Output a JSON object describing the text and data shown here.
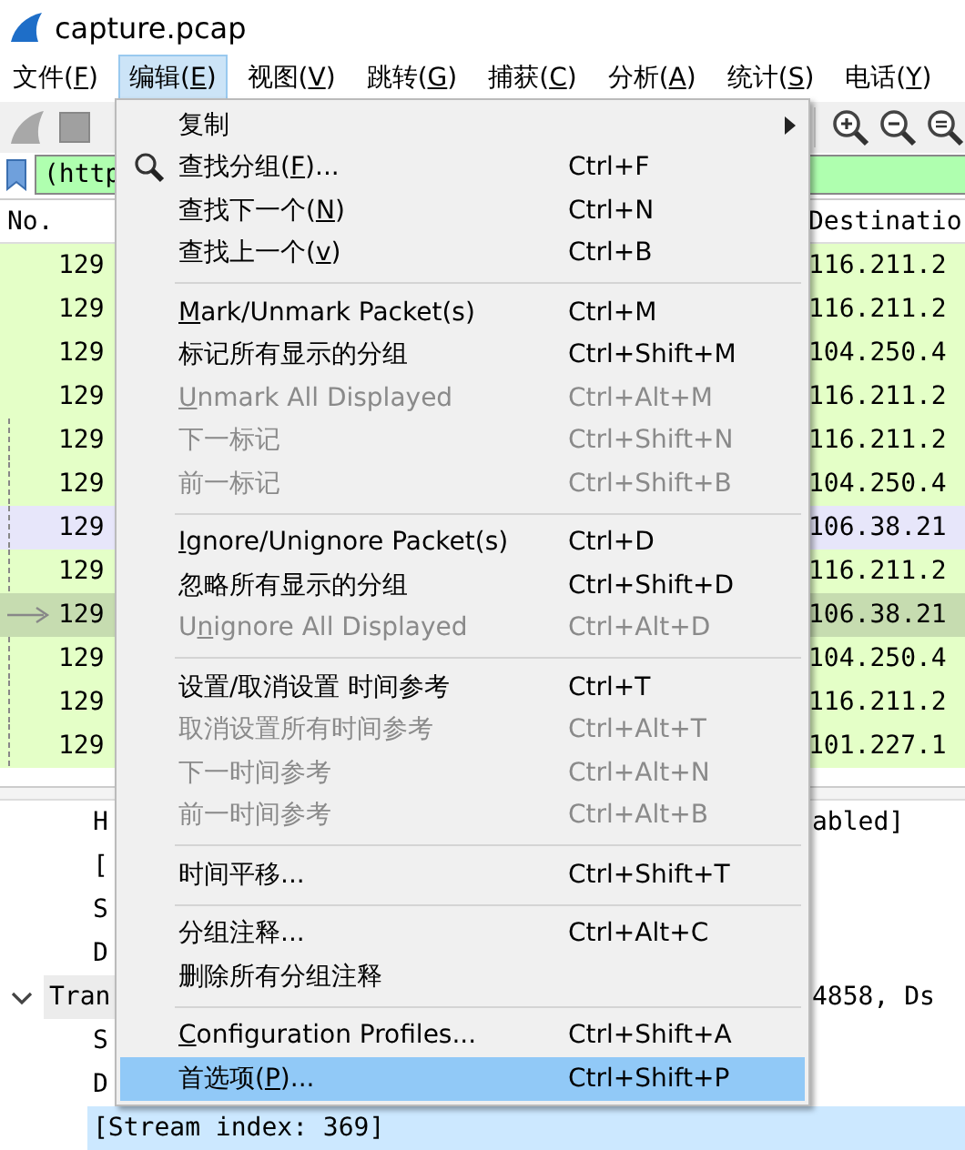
{
  "window": {
    "title": "capture.pcap"
  },
  "menubar": [
    {
      "label": [
        "文件(",
        "F",
        ")"
      ],
      "selected": false
    },
    {
      "label": [
        "编辑(",
        "E",
        ")"
      ],
      "selected": true
    },
    {
      "label": [
        "视图(",
        "V",
        ")"
      ],
      "selected": false
    },
    {
      "label": [
        "跳转(",
        "G",
        ")"
      ],
      "selected": false
    },
    {
      "label": [
        "捕获(",
        "C",
        ")"
      ],
      "selected": false
    },
    {
      "label": [
        "分析(",
        "A",
        ")"
      ],
      "selected": false
    },
    {
      "label": [
        "统计(",
        "S",
        ")"
      ],
      "selected": false
    },
    {
      "label": [
        "电话(",
        "Y",
        ")"
      ],
      "selected": false
    }
  ],
  "filter": {
    "value": "(http"
  },
  "packet_list": {
    "columns": [
      "No.",
      "Destinatio"
    ],
    "rows": [
      {
        "no": "129",
        "destination": "116.211.2",
        "color": "#e4ffc7",
        "related": false,
        "selected": false
      },
      {
        "no": "129",
        "destination": "116.211.2",
        "color": "#e4ffc7",
        "related": false,
        "selected": false
      },
      {
        "no": "129",
        "destination": "104.250.4",
        "color": "#e4ffc7",
        "related": false,
        "selected": false
      },
      {
        "no": "129",
        "destination": "116.211.2",
        "color": "#e4ffc7",
        "related": false,
        "selected": false
      },
      {
        "no": "129",
        "destination": "116.211.2",
        "color": "#e4ffc7",
        "related": true,
        "selected": false
      },
      {
        "no": "129",
        "destination": "104.250.4",
        "color": "#e4ffc7",
        "related": true,
        "selected": false
      },
      {
        "no": "129",
        "destination": "106.38.21",
        "color": "#e7e6fa",
        "related": true,
        "selected": false
      },
      {
        "no": "129",
        "destination": "116.211.2",
        "color": "#e4ffc7",
        "related": true,
        "selected": false
      },
      {
        "no": "129",
        "destination": "106.38.21",
        "color": "#c6dcb0",
        "related": true,
        "selected": true
      },
      {
        "no": "129",
        "destination": "104.250.4",
        "color": "#e4ffc7",
        "related": true,
        "selected": false
      },
      {
        "no": "129",
        "destination": "116.211.2",
        "color": "#e4ffc7",
        "related": true,
        "selected": false
      },
      {
        "no": "129",
        "destination": "101.227.1",
        "color": "#e4ffc7",
        "related": true,
        "selected": false
      }
    ]
  },
  "packet_details": [
    {
      "kind": "field",
      "left": "H",
      "right": "abled]",
      "selected": false
    },
    {
      "kind": "field",
      "left": "[",
      "selected": false
    },
    {
      "kind": "field",
      "left": "S",
      "selected": false
    },
    {
      "kind": "field",
      "left": "D",
      "selected": false
    },
    {
      "kind": "node",
      "left": "Tran",
      "right": "4858, Ds",
      "expanded": true,
      "selected": false
    },
    {
      "kind": "field",
      "left": "S",
      "selected": false
    },
    {
      "kind": "field",
      "left": "D",
      "selected": false
    },
    {
      "kind": "field",
      "left": "[Stream index: 369]",
      "selected": true
    }
  ],
  "edit_menu": [
    {
      "kind": "item",
      "label": {
        "pre": "复制"
      },
      "submenu": true,
      "disabled": false,
      "selected": false
    },
    {
      "kind": "item",
      "label": {
        "pre": "查找分组(",
        "key": "F",
        "post": ")..."
      },
      "shortcut": "Ctrl+F",
      "icon": true,
      "disabled": false,
      "selected": false
    },
    {
      "kind": "item",
      "label": {
        "pre": "查找下一个(",
        "key": "N",
        "post": ")"
      },
      "shortcut": "Ctrl+N",
      "disabled": false,
      "selected": false
    },
    {
      "kind": "item",
      "label": {
        "pre": "查找上一个(",
        "key": "v",
        "post": ")"
      },
      "shortcut": "Ctrl+B",
      "disabled": false,
      "selected": false
    },
    {
      "kind": "separator"
    },
    {
      "kind": "item",
      "label": {
        "key": "M",
        "post": "ark/Unmark Packet(s)"
      },
      "shortcut": "Ctrl+M",
      "disabled": false,
      "selected": false
    },
    {
      "kind": "item",
      "label": {
        "pre": "标记所有显示的分组"
      },
      "shortcut": "Ctrl+Shift+M",
      "disabled": false,
      "selected": false
    },
    {
      "kind": "item",
      "label": {
        "key": "U",
        "post": "nmark All Displayed"
      },
      "shortcut": "Ctrl+Alt+M",
      "disabled": true,
      "selected": false
    },
    {
      "kind": "item",
      "label": {
        "pre": "下一标记"
      },
      "shortcut": "Ctrl+Shift+N",
      "disabled": true,
      "selected": false
    },
    {
      "kind": "item",
      "label": {
        "pre": "前一标记"
      },
      "shortcut": "Ctrl+Shift+B",
      "disabled": true,
      "selected": false
    },
    {
      "kind": "separator"
    },
    {
      "kind": "item",
      "label": {
        "key": "I",
        "post": "gnore/Unignore Packet(s)"
      },
      "shortcut": "Ctrl+D",
      "disabled": false,
      "selected": false
    },
    {
      "kind": "item",
      "label": {
        "pre": "忽略所有显示的分组"
      },
      "shortcut": "Ctrl+Shift+D",
      "disabled": false,
      "selected": false
    },
    {
      "kind": "item",
      "label": {
        "pre": "U",
        "key": "n",
        "post": "ignore All Displayed"
      },
      "shortcut": "Ctrl+Alt+D",
      "disabled": true,
      "selected": false
    },
    {
      "kind": "separator"
    },
    {
      "kind": "item",
      "label": {
        "pre": "设置/取消设置 时间参考"
      },
      "shortcut": "Ctrl+T",
      "disabled": false,
      "selected": false
    },
    {
      "kind": "item",
      "label": {
        "pre": "取消设置所有时间参考"
      },
      "shortcut": "Ctrl+Alt+T",
      "disabled": true,
      "selected": false
    },
    {
      "kind": "item",
      "label": {
        "pre": "下一时间参考"
      },
      "shortcut": "Ctrl+Alt+N",
      "disabled": true,
      "selected": false
    },
    {
      "kind": "item",
      "label": {
        "pre": "前一时间参考"
      },
      "shortcut": "Ctrl+Alt+B",
      "disabled": true,
      "selected": false
    },
    {
      "kind": "separator"
    },
    {
      "kind": "item",
      "label": {
        "pre": "时间平移..."
      },
      "shortcut": "Ctrl+Shift+T",
      "disabled": false,
      "selected": false
    },
    {
      "kind": "separator"
    },
    {
      "kind": "item",
      "label": {
        "pre": "分组注释..."
      },
      "shortcut": "Ctrl+Alt+C",
      "disabled": false,
      "selected": false
    },
    {
      "kind": "item",
      "label": {
        "pre": "删除所有分组注释"
      },
      "disabled": false,
      "selected": false
    },
    {
      "kind": "separator"
    },
    {
      "kind": "item",
      "label": {
        "key": "C",
        "post": "onfiguration Profiles..."
      },
      "shortcut": "Ctrl+Shift+A",
      "disabled": false,
      "selected": false
    },
    {
      "kind": "item",
      "label": {
        "pre": "首选项(",
        "key": "P",
        "post": ")..."
      },
      "shortcut": "Ctrl+Shift+P",
      "disabled": false,
      "selected": true
    }
  ]
}
